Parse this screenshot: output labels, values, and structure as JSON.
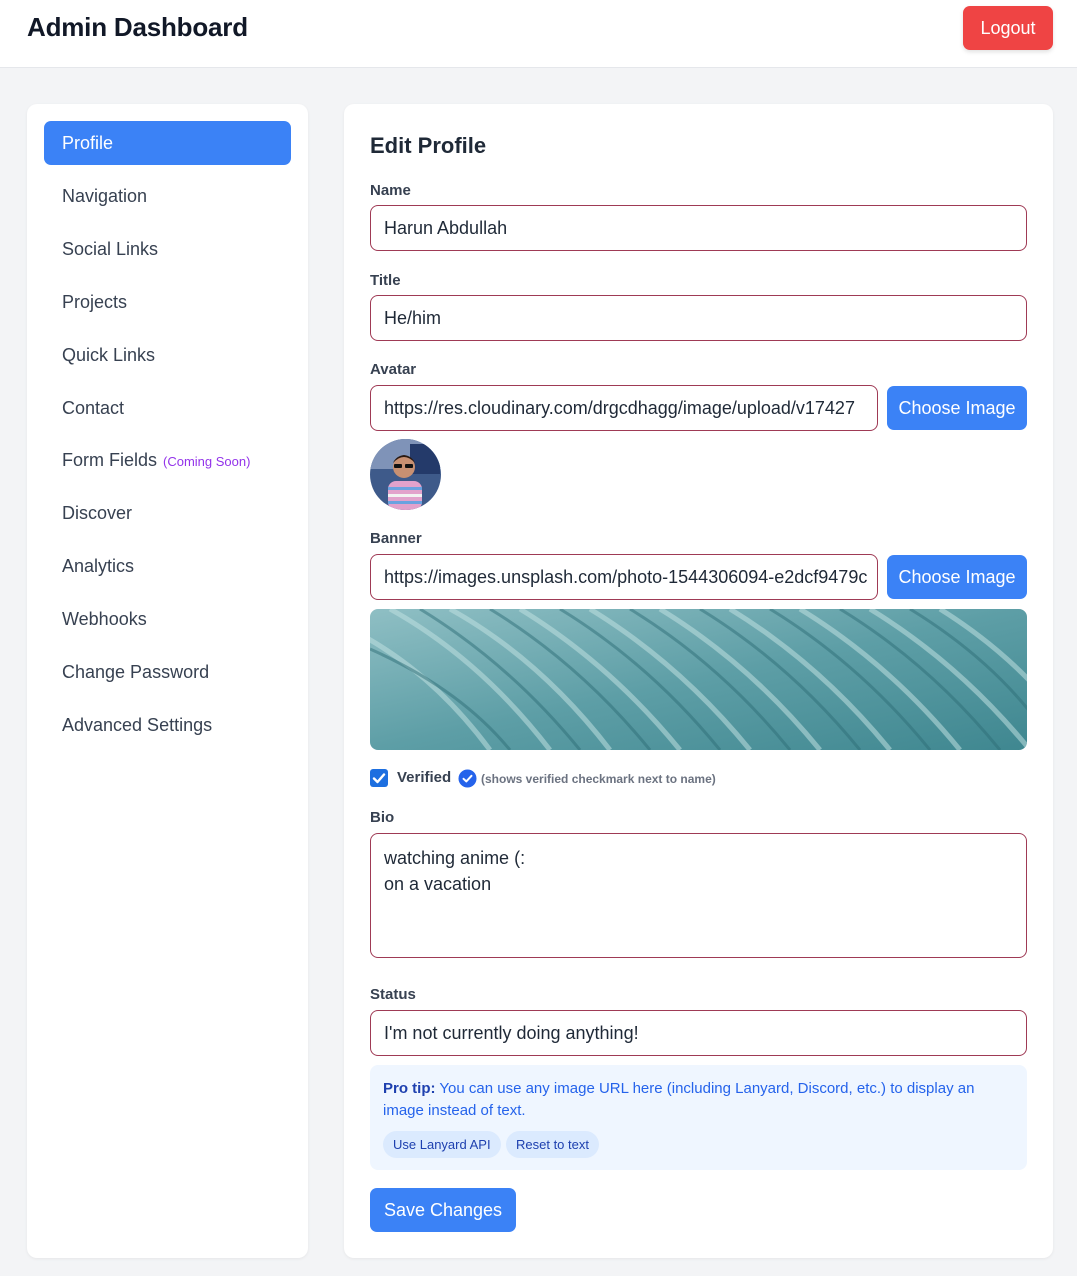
{
  "header": {
    "title": "Admin Dashboard",
    "logout_label": "Logout"
  },
  "sidebar": {
    "items": [
      {
        "label": "Profile",
        "active": true
      },
      {
        "label": "Navigation"
      },
      {
        "label": "Social Links"
      },
      {
        "label": "Projects"
      },
      {
        "label": "Quick Links"
      },
      {
        "label": "Contact"
      },
      {
        "label": "Form Fields",
        "badge": "(Coming Soon)"
      },
      {
        "label": "Discover"
      },
      {
        "label": "Analytics"
      },
      {
        "label": "Webhooks"
      },
      {
        "label": "Change Password"
      },
      {
        "label": "Advanced Settings"
      }
    ]
  },
  "form": {
    "heading": "Edit Profile",
    "name": {
      "label": "Name",
      "value": "Harun Abdullah"
    },
    "title": {
      "label": "Title",
      "value": "He/him"
    },
    "avatar": {
      "label": "Avatar",
      "value": "https://res.cloudinary.com/drgcdhagg/image/upload/v17427",
      "button": "Choose Image"
    },
    "banner": {
      "label": "Banner",
      "value": "https://images.unsplash.com/photo-1544306094-e2dcf9479c",
      "button": "Choose Image"
    },
    "verified": {
      "label": "Verified",
      "checked": true,
      "hint": "(shows verified checkmark next to name)"
    },
    "bio": {
      "label": "Bio",
      "value": "watching anime (:\non a vacation"
    },
    "status": {
      "label": "Status",
      "value": "I'm not currently doing anything!"
    },
    "tip": {
      "strong": "Pro tip:",
      "text": " You can use any image URL here (including Lanyard, Discord, etc.) to display an image instead of text.",
      "buttons": [
        "Use Lanyard API",
        "Reset to text"
      ]
    },
    "save_label": "Save Changes"
  },
  "colors": {
    "primary": "#3b82f6",
    "danger": "#ef4444",
    "input_border": "#9f3a55",
    "tip_bg": "#eff6ff"
  }
}
